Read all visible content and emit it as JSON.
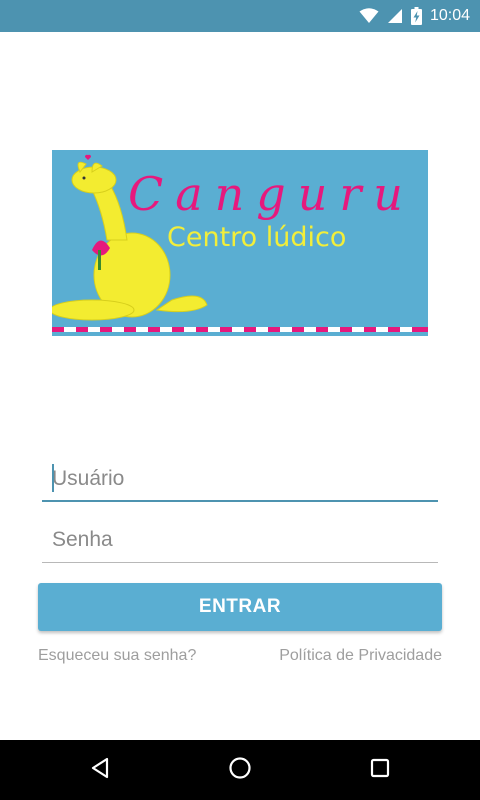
{
  "status_bar": {
    "time": "10:04",
    "icons": [
      "wifi-icon",
      "signal-icon",
      "battery-charging-icon"
    ]
  },
  "logo": {
    "title": "Canguru",
    "subtitle": "Centro lúdico",
    "colors": {
      "background": "#5aaed2",
      "title": "#e6197d",
      "subtitle": "#f2ee3a",
      "kangaroo": "#f3ec30",
      "stripe": "#e6197d"
    }
  },
  "form": {
    "username_placeholder": "Usuário",
    "password_placeholder": "Senha",
    "submit_label": "ENTRAR"
  },
  "links": {
    "forgot_password": "Esqueceu sua senha?",
    "privacy_policy": "Política de Privacidade"
  },
  "nav_bar": {
    "icons": [
      "back-icon",
      "home-icon",
      "recent-apps-icon"
    ]
  },
  "colors": {
    "accent": "#4d93b0",
    "button": "#5aaed2",
    "link": "#9e9e9e"
  }
}
